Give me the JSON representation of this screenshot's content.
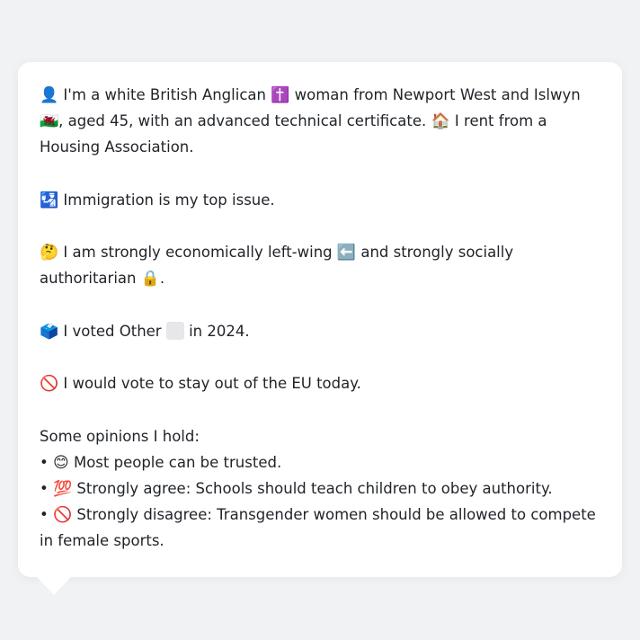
{
  "profile": {
    "intro_icon": "bust-in-silhouette-icon",
    "intro_a": "I'm a white British Anglican",
    "cross_icon": "latin-cross-icon",
    "intro_b": "woman from Newport West and Islwyn",
    "flag_icon": "wales-flag-icon",
    "intro_c": ", aged 45, with an advanced technical certificate.",
    "house_icon": "house-icon",
    "intro_d": "I rent from a Housing Association.",
    "issue_icon": "passport-control-icon",
    "issue_text": "Immigration is my top issue.",
    "thinking_icon": "thinking-face-icon",
    "ideology_a": "I am strongly economically left-wing",
    "left_arrow_icon": "left-arrow-icon",
    "ideology_b": "and strongly socially authoritarian",
    "lock_icon": "lock-icon",
    "ideology_c": ".",
    "ballot_icon": "ballot-box-icon",
    "vote_a": "I voted Other",
    "party_color": "#e7e7e9",
    "vote_b": "in 2024.",
    "eu_icon": "prohibited-icon",
    "eu_text": "I would vote to stay out of the EU today."
  },
  "opinions": {
    "heading": "Some opinions I hold:",
    "items": [
      {
        "bullet": "•",
        "icon": "smiling-face-icon",
        "text": "Most people can be trusted."
      },
      {
        "bullet": "•",
        "icon": "hundred-points-icon",
        "text": "Strongly agree: Schools should teach children to obey authority."
      },
      {
        "bullet": "•",
        "icon": "prohibited-icon",
        "text": "Strongly disagree: Transgender women should be allowed to compete in female sports."
      }
    ]
  }
}
